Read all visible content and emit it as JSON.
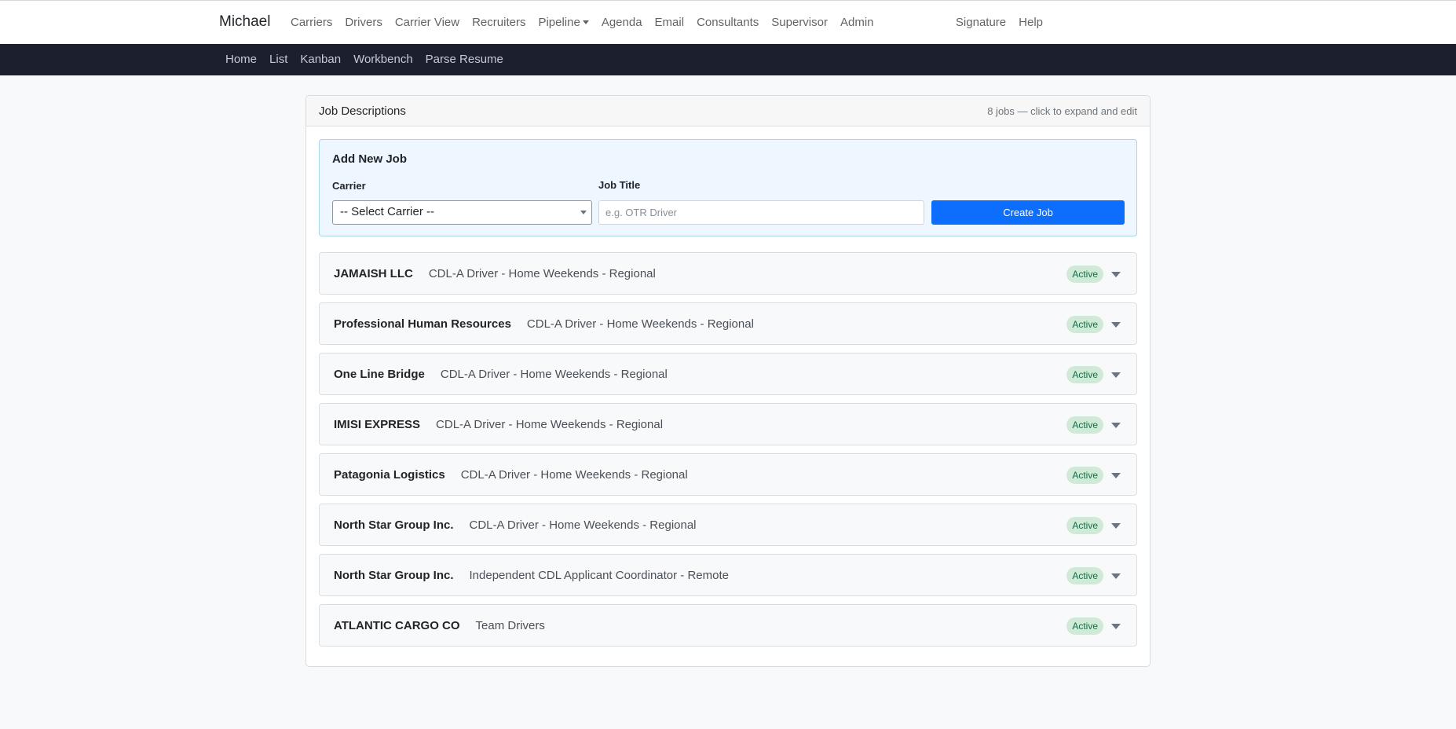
{
  "brand": "Michael",
  "nav": {
    "left": [
      {
        "label": "Carriers"
      },
      {
        "label": "Drivers"
      },
      {
        "label": "Carrier View"
      },
      {
        "label": "Recruiters"
      },
      {
        "label": "Pipeline",
        "dropdown": true
      },
      {
        "label": "Agenda"
      },
      {
        "label": "Email"
      },
      {
        "label": "Consultants"
      },
      {
        "label": "Supervisor"
      },
      {
        "label": "Admin"
      }
    ],
    "right": [
      {
        "label": "Signature"
      },
      {
        "label": "Help"
      }
    ]
  },
  "subnav": [
    "Home",
    "List",
    "Kanban",
    "Workbench",
    "Parse Resume"
  ],
  "card": {
    "title": "Job Descriptions",
    "hint": "8 jobs — click to expand and edit"
  },
  "add_job": {
    "title": "Add New Job",
    "carrier_label": "Carrier",
    "carrier_value": "-- Select Carrier --",
    "job_title_label": "Job Title",
    "job_title_placeholder": "e.g. OTR Driver",
    "create_label": "Create Job"
  },
  "jobs": [
    {
      "carrier": "JAMAISH LLC",
      "title": "CDL-A Driver - Home Weekends - Regional",
      "status": "Active"
    },
    {
      "carrier": "Professional Human Resources",
      "title": "CDL-A Driver - Home Weekends - Regional",
      "status": "Active"
    },
    {
      "carrier": "One Line Bridge",
      "title": "CDL-A Driver - Home Weekends - Regional",
      "status": "Active"
    },
    {
      "carrier": "IMISI EXPRESS",
      "title": "CDL-A Driver - Home Weekends - Regional",
      "status": "Active"
    },
    {
      "carrier": "Patagonia Logistics",
      "title": "CDL-A Driver - Home Weekends - Regional",
      "status": "Active"
    },
    {
      "carrier": "North Star Group Inc.",
      "title": "CDL-A Driver - Home Weekends - Regional",
      "status": "Active"
    },
    {
      "carrier": "North Star Group Inc.",
      "title": "Independent CDL Applicant Coordinator - Remote",
      "status": "Active"
    },
    {
      "carrier": "ATLANTIC CARGO CO",
      "title": "Team Drivers",
      "status": "Active"
    }
  ],
  "colors": {
    "primary": "#0d6efd",
    "subnav_bg": "#1c1f2e",
    "badge_bg": "#d1ead7",
    "badge_text": "#146c43"
  }
}
